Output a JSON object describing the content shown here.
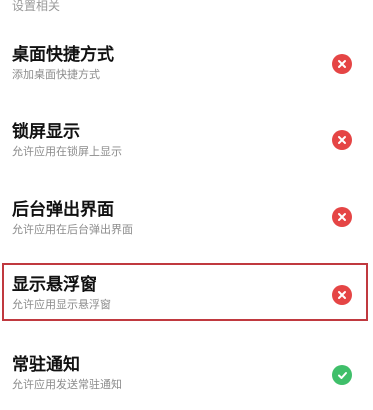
{
  "section_header": "设置相关",
  "settings": [
    {
      "title": "桌面快捷方式",
      "description": "添加桌面快捷方式",
      "status": "denied",
      "status_color": "#e54545",
      "status_icon": "close-icon"
    },
    {
      "title": "锁屏显示",
      "description": "允许应用在锁屏上显示",
      "status": "denied",
      "status_color": "#e54545",
      "status_icon": "close-icon"
    },
    {
      "title": "后台弹出界面",
      "description": "允许应用在后台弹出界面",
      "status": "denied",
      "status_color": "#e54545",
      "status_icon": "close-icon"
    },
    {
      "title": "显示悬浮窗",
      "description": "允许应用显示悬浮窗",
      "status": "denied",
      "status_color": "#e54545",
      "status_icon": "close-icon",
      "highlighted": true,
      "highlight_color": "#c0393f"
    },
    {
      "title": "常驻通知",
      "description": "允许应用发送常驻通知",
      "status": "allowed",
      "status_color": "#3fbf6a",
      "status_icon": "check-icon"
    }
  ]
}
